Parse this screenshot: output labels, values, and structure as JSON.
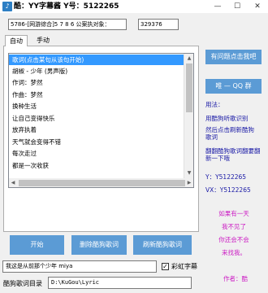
{
  "window": {
    "title": "酷：YY字幕酱  Y号：5122265",
    "app_icon": "music-note-icon",
    "minimize_symbol": "—",
    "maximize_symbol": "☐",
    "close_symbol": "✕"
  },
  "top": {
    "song_field_value": "5786-[网游综合]5 7 8 6 公案执对象：",
    "id_field_value": "329376"
  },
  "tabs": [
    {
      "label": "自动",
      "active": true
    },
    {
      "label": "手动",
      "active": false
    }
  ],
  "lyrics": {
    "rows": [
      "歌词(点击某句从该句开始)",
      "胡椒 - 少年 (男声版)",
      "作词：梦然",
      "作曲：梦然",
      "换种生活",
      "让自己变得快乐",
      "放弃执着",
      "天气就会变得不错",
      "每次走过",
      "都是一次收获"
    ],
    "selected_index": 0
  },
  "buttons": {
    "start": "开始",
    "delete_lyrics": "删除酷狗歌词",
    "refresh_lyrics": "刷新酷狗歌词",
    "open_homepage": "有问题点击我吧",
    "qq_group": "唯 — QQ 群"
  },
  "side": {
    "usage_title": "用法：",
    "usage_1": "用酷狗听歌识别",
    "usage_2a": "然后点击刷新酷狗",
    "usage_2b": "歌词",
    "usage_3a": "翻翻酷狗歌词翻要翻",
    "usage_3b": "新一下哦",
    "yy_label": "Y：Y5122265",
    "vx_label": "VX：Y5122265",
    "pink_lines": [
      "如果有一天",
      "我不见了",
      "你还会不会",
      "来找我。"
    ],
    "author": "作者：酷"
  },
  "bottom": {
    "now_playing": "我这是从前那个少年 miya",
    "rainbow_checkbox_label": "彩虹字幕",
    "rainbow_checked": true,
    "dir_label": "酷狗歌词目录",
    "dir_value": "D:\\KuGou\\Lyric"
  }
}
